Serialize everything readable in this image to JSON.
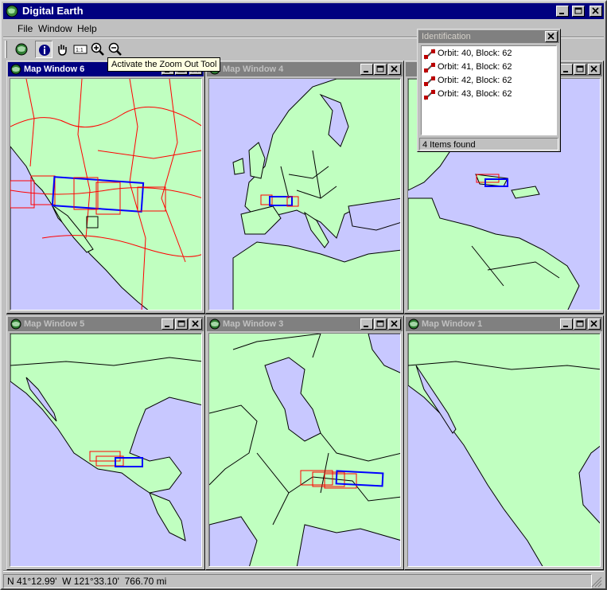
{
  "app": {
    "title": "Digital Earth"
  },
  "menu": [
    {
      "label": "File"
    },
    {
      "label": "Window"
    },
    {
      "label": "Help"
    }
  ],
  "toolbar": {
    "buttons": [
      {
        "icon": "globe-icon"
      },
      {
        "icon": "info-icon"
      },
      {
        "icon": "hand-pan-icon"
      },
      {
        "icon": "scale-icon"
      },
      {
        "icon": "zoom-in-icon"
      },
      {
        "icon": "zoom-out-icon"
      }
    ],
    "tooltip": "Activate the Zoom Out Tool"
  },
  "map_windows": [
    {
      "id": "6",
      "title": "Map Window 6",
      "active": true
    },
    {
      "id": "4",
      "title": "Map Window 4",
      "active": false
    },
    {
      "id": "2",
      "title": "",
      "active": false
    },
    {
      "id": "5",
      "title": "Map Window 5",
      "active": false
    },
    {
      "id": "3",
      "title": "Map Window 3",
      "active": false
    },
    {
      "id": "1",
      "title": "Map Window 1",
      "active": false
    }
  ],
  "identification": {
    "title": "Identification",
    "items": [
      {
        "label": "Orbit: 40, Block: 62"
      },
      {
        "label": "Orbit: 41, Block: 62"
      },
      {
        "label": "Orbit: 42, Block: 62"
      },
      {
        "label": "Orbit: 43, Block: 62"
      }
    ],
    "status": "4 Items found"
  },
  "statusbar": {
    "text": "N 41°12.99'  W 121°33.10'  766.70 mi"
  },
  "colors": {
    "land": "#c0ffc0",
    "water": "#c8c8ff",
    "footprint": "#ff0000",
    "selected": "#0000ff",
    "title_active": "#000080"
  }
}
